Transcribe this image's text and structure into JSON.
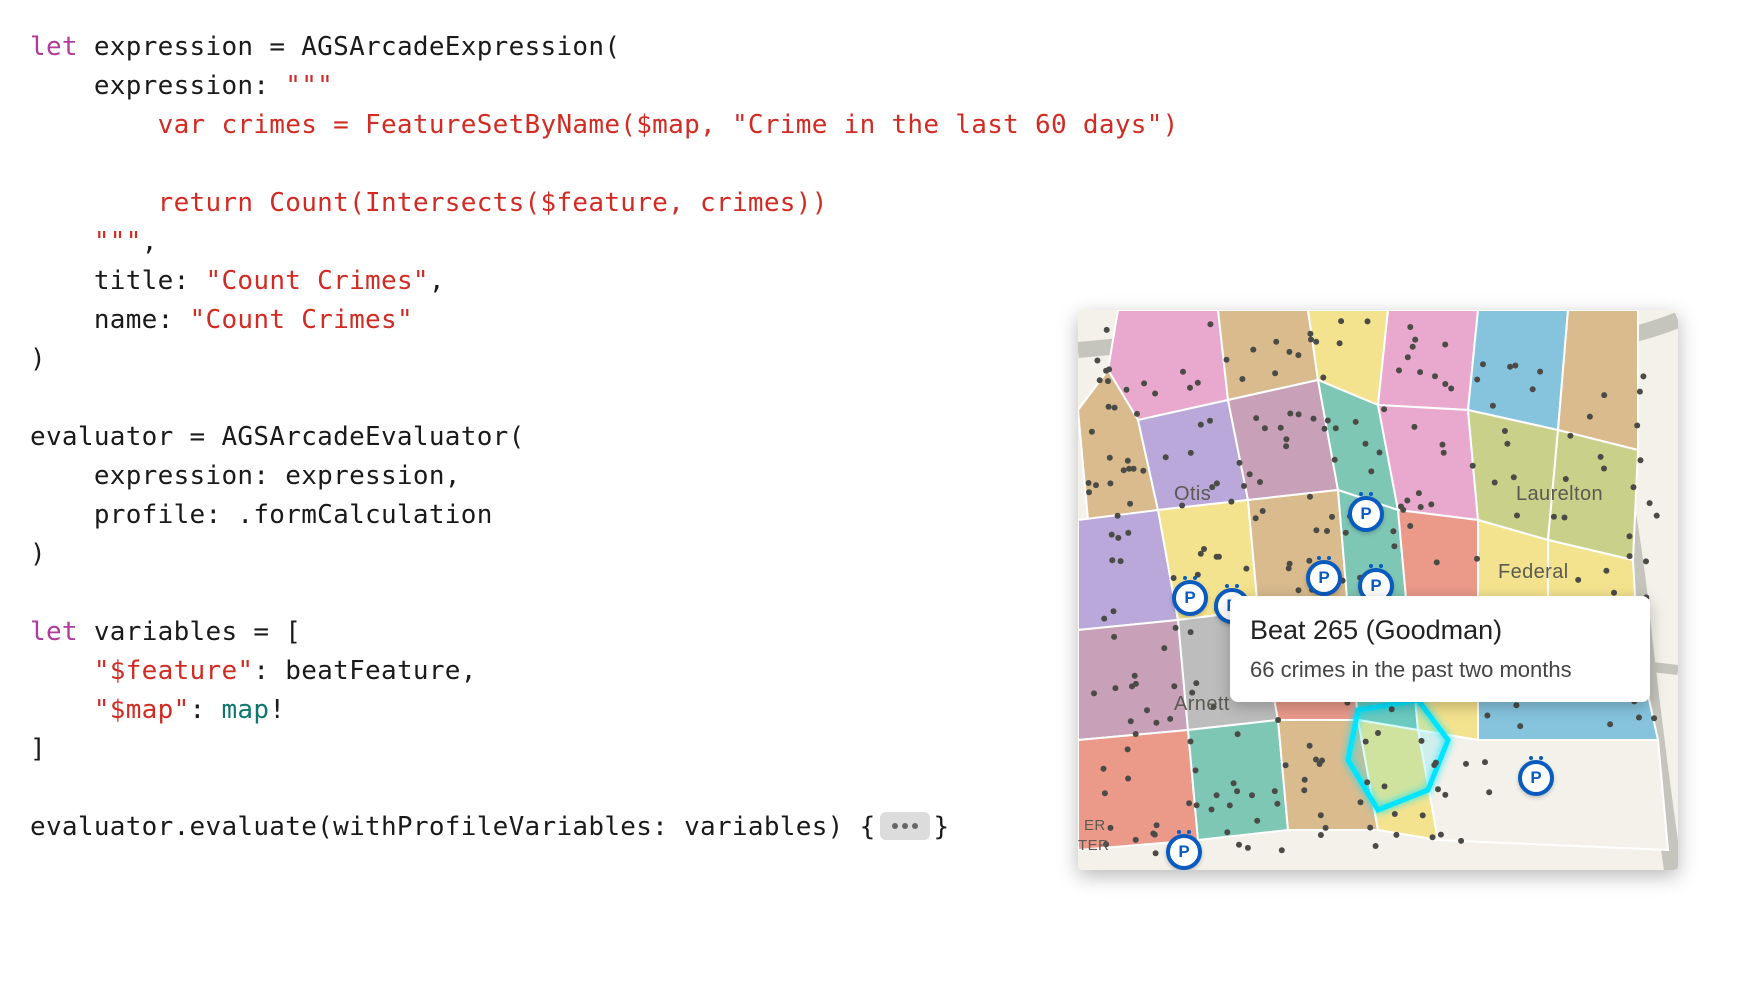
{
  "code": {
    "let1": "let",
    "expr_var": " expression = AGSArcadeExpression(",
    "expr_label": "    expression: ",
    "expr_open": "\"\"\"",
    "expr_l1": "        var crimes = FeatureSetByName($map, \"Crime in the last 60 days\")",
    "expr_blank": "",
    "expr_l2": "        return Count(Intersects($feature, crimes))",
    "expr_close": "    \"\"\"",
    "comma1": ",",
    "title_label": "    title: ",
    "title_val": "\"Count Crimes\"",
    "comma2": ",",
    "name_label": "    name: ",
    "name_val": "\"Count Crimes\"",
    "close1": ")",
    "eval_line": "evaluator = AGSArcadeEvaluator(",
    "eval_expr": "    expression: expression,",
    "eval_profile": "    profile: .formCalculation",
    "close2": ")",
    "let2": "let",
    "vars_open": " variables = [",
    "feat_key": "    \"$feature\"",
    "feat_val": ": beatFeature,",
    "map_key": "    \"$map\"",
    "map_colon": ": ",
    "map_val": "map",
    "map_bang": "!",
    "vars_close": "]",
    "eval_call_pre": "evaluator.evaluate(withProfileVariables: variables) {",
    "eval_call_post": "}"
  },
  "map": {
    "labels": {
      "otis": "Otis",
      "laurelton": "Laurelton",
      "federal": "Federal",
      "arnett": "Arnett",
      "er": "ER",
      "ter": "TER"
    },
    "callout": {
      "title": "Beat 265 (Goodman)",
      "subtitle": "66 crimes in the past two months"
    },
    "marker_letter": "P",
    "region_colors": {
      "pink": "#e9a8cd",
      "yellow": "#f4e38e",
      "blue": "#86c4de",
      "teal": "#7fc7b5",
      "purple": "#b9a8d9",
      "tan": "#d9bb8e",
      "coral": "#eb9a8a",
      "olive": "#c9d08a",
      "mauve": "#c8a0b8",
      "sky": "#a8cdea"
    }
  }
}
